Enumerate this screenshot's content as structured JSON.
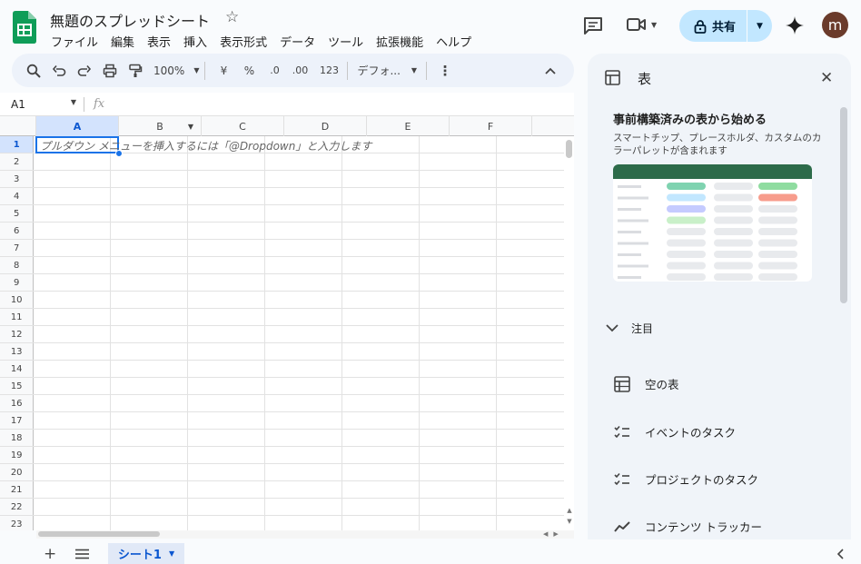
{
  "app": {
    "title": "無題のスプレッドシート",
    "menus": [
      "ファイル",
      "編集",
      "表示",
      "挿入",
      "表示形式",
      "データ",
      "ツール",
      "拡張機能",
      "ヘルプ"
    ],
    "share_label": "共有",
    "avatar_letter": "m"
  },
  "toolbar": {
    "zoom": "100%",
    "currency": "¥",
    "percent": "%",
    "dec_decrease": ".0",
    "dec_increase": ".00",
    "number_format": "123",
    "font": "デフォ..."
  },
  "formula_bar": {
    "cell_ref": "A1",
    "fx": "fx"
  },
  "grid": {
    "columns": [
      "A",
      "B",
      "C",
      "D",
      "E",
      "F"
    ],
    "rows": [
      "1",
      "2",
      "3",
      "4",
      "5",
      "6",
      "7",
      "8",
      "9",
      "10",
      "11",
      "12",
      "13",
      "14",
      "15",
      "16",
      "17",
      "18",
      "19",
      "20",
      "21",
      "22",
      "23"
    ],
    "cell_hint": "プルダウン メニューを挿入するには「@Dropdown」と入力します"
  },
  "sheet_tabs": [
    {
      "label": "シート1"
    }
  ],
  "side_panel": {
    "title": "表",
    "prebuilt": {
      "heading": "事前構築済みの表から始める",
      "description": "スマートチップ、プレースホルダ、カスタムのカラーパレットが含まれます"
    },
    "section_label": "注目",
    "templates": [
      {
        "label": "空の表",
        "icon": "table-icon"
      },
      {
        "label": "イベントのタスク",
        "icon": "checklist-icon"
      },
      {
        "label": "プロジェクトのタスク",
        "icon": "checklist-icon"
      },
      {
        "label": "コンテンツ トラッカー",
        "icon": "trend-icon"
      }
    ]
  },
  "colors": {
    "accent": "#1a73e8",
    "share_bg": "#c2e7ff",
    "panel_bg": "#f0f4f9",
    "sheets_green": "#0f9d58"
  }
}
